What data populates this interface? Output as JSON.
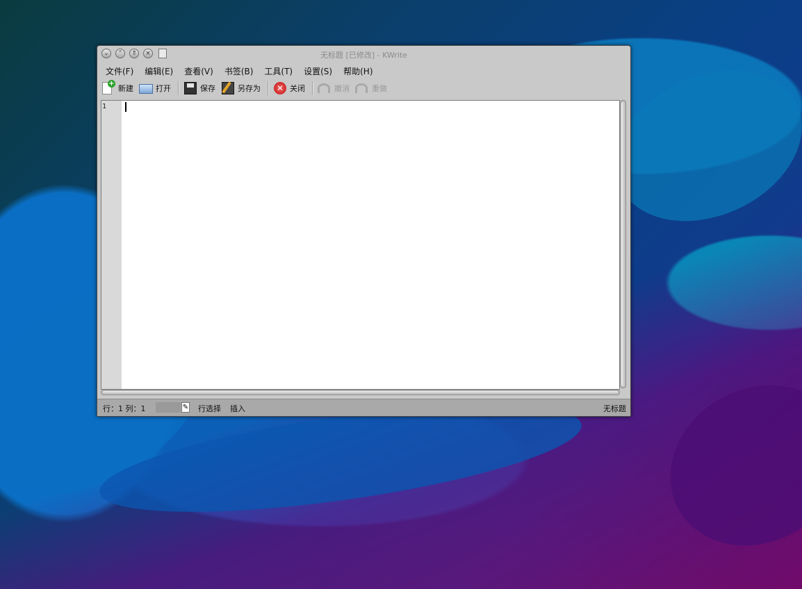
{
  "window": {
    "title": "无标题 [已修改] - KWrite"
  },
  "menubar": {
    "items": [
      {
        "label": "文件(F)"
      },
      {
        "label": "编辑(E)"
      },
      {
        "label": "查看(V)"
      },
      {
        "label": "书签(B)"
      },
      {
        "label": "工具(T)"
      },
      {
        "label": "设置(S)"
      },
      {
        "label": "帮助(H)"
      }
    ]
  },
  "toolbar": {
    "new_label": "新建",
    "open_label": "打开",
    "save_label": "保存",
    "saveas_label": "另存为",
    "close_label": "关闭",
    "undo_label": "撤消",
    "redo_label": "重做"
  },
  "editor": {
    "line_number": "1",
    "content": ""
  },
  "statusbar": {
    "position": "行：1 列：1",
    "selection_mode": "行选择",
    "insert_mode": "插入",
    "document_name": "无标题"
  },
  "icons": {
    "new": "new-document-icon",
    "open": "open-folder-icon",
    "save": "save-disk-icon",
    "saveas": "save-as-icon",
    "close": "close-icon",
    "undo": "undo-icon",
    "redo": "redo-icon"
  },
  "colors": {
    "window_bg": "#c9c9c9",
    "statusbar_bg": "#a9a9a9",
    "gutter_bg": "#d9d9d9",
    "close_red": "#c21414",
    "new_green": "#2aa12a"
  }
}
